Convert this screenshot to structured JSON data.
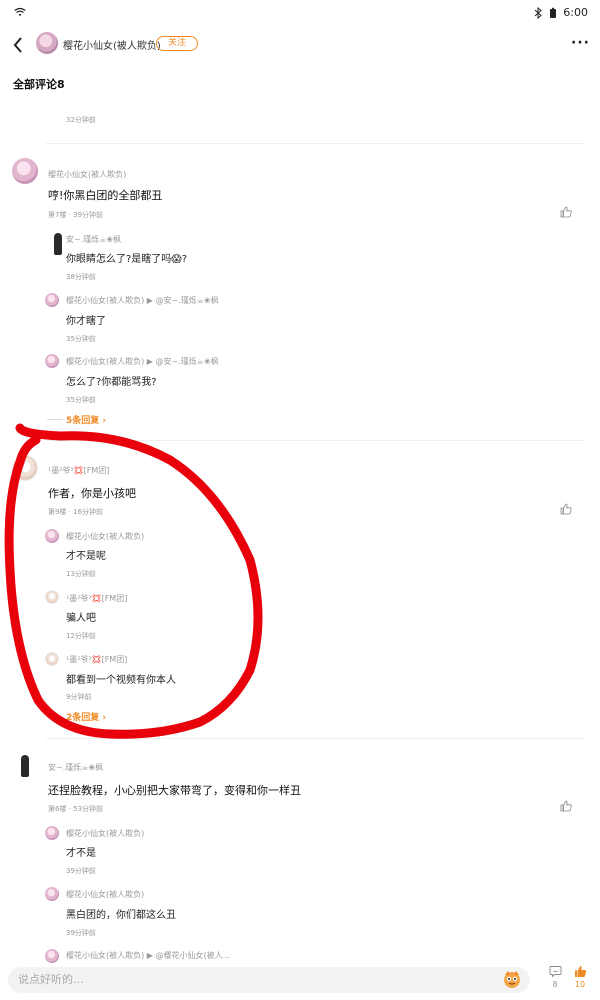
{
  "status_bar": {
    "time": "6:00"
  },
  "header": {
    "username": "樱花小仙女(被人欺负)",
    "follow_label": "关注"
  },
  "section_title": "全部评论8",
  "top_partial": {
    "time": "32分钟前"
  },
  "comments": [
    {
      "author": "樱花小仙女(被人欺负)",
      "text": "哼!你黑白团的全部都丑",
      "meta": "第7楼 · 39分钟前",
      "replies": [
        {
          "author": "安~.瑾烁☕❀枫",
          "target": "",
          "text": "你眼睛怎么了?是瞎了吗😱?",
          "time": "38分钟前"
        },
        {
          "author": "樱花小仙女(被人欺负)",
          "target": "▶ @安~.瑾烁☕❀枫",
          "text": "你才瞎了",
          "time": "35分钟前"
        },
        {
          "author": "樱花小仙女(被人欺负)",
          "target": "▶ @安~.瑾烁☕❀枫",
          "text": "怎么了?你都能骂我?",
          "time": "35分钟前"
        }
      ],
      "more_replies": "5条回复"
    },
    {
      "author": "¹墨²爷³💢[FM团]",
      "text": "作者，你是小孩吧",
      "meta": "第9楼 · 16分钟前",
      "replies": [
        {
          "author": "樱花小仙女(被人欺负)",
          "target": "",
          "text": "才不是呢",
          "time": "13分钟前"
        },
        {
          "author": "¹墨²爷³💢[FM团]",
          "target": "",
          "text": "骗人吧",
          "time": "12分钟前"
        },
        {
          "author": "¹墨²爷³💢[FM团]",
          "target": "",
          "text": "都看到一个视频有你本人",
          "time": "9分钟前"
        }
      ],
      "more_replies": "2条回复"
    },
    {
      "author": "安~.瑾烁☕❀枫",
      "text": "还捏脸教程，小心别把大家带弯了，变得和你一样丑",
      "meta": "第6楼 · 53分钟前",
      "replies": [
        {
          "author": "樱花小仙女(被人欺负)",
          "target": "",
          "text": "才不是",
          "time": "39分钟前"
        },
        {
          "author": "樱花小仙女(被人欺负)",
          "target": "",
          "text": "黑白团的，你们都这么丑",
          "time": "39分钟前"
        },
        {
          "author": "樱花小仙女(被人欺负)",
          "target": "▶ @樱花小仙女(被人...",
          "text": "",
          "time": ""
        }
      ]
    }
  ],
  "bottom_bar": {
    "input_placeholder": "说点好听的…",
    "comment_count": "8",
    "like_count": "10"
  },
  "colors": {
    "accent": "#f08a24",
    "annotation": "#e8000b"
  }
}
